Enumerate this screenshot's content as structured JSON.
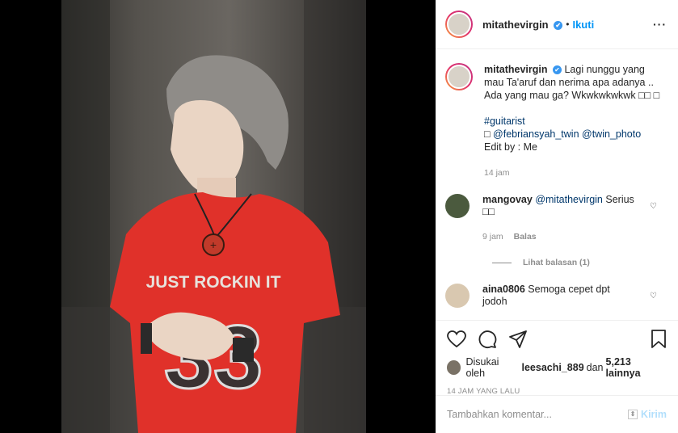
{
  "post": {
    "image_alt": "Photo by mitathevirgin",
    "shirt_text": "JUST ROCKIN IT",
    "shirt_number": "33"
  },
  "header": {
    "username": "mitathevirgin",
    "verified_icon": "✔",
    "separator": "•",
    "follow_label": "Ikuti",
    "more_label": "···"
  },
  "caption": {
    "username": "mitathevirgin",
    "text": "Lagi nunggu yang mau Ta'aruf dan nerima apa adanya .. Ada yang mau ga? Wkwkwkwkwk □□ □",
    "hashtag": "#guitarist",
    "credit_prefix": "□ ",
    "mention1": "@febriansyah_twin",
    "mention2": "@twin_photo",
    "edit_by": "Edit by : Me",
    "time": "14 jam"
  },
  "comments": [
    {
      "username": "mangovay",
      "mention": "@mitathevirgin",
      "text": " Serius □□",
      "time": "9 jam",
      "reply_label": "Balas",
      "view_replies": "Lihat balasan (1)"
    },
    {
      "username": "aina0806",
      "text": " Semoga cepet dpt jodoh"
    }
  ],
  "actions": {
    "likes_prefix": "Disukai oleh ",
    "liked_by": "leesachi_889",
    "likes_middle": " dan ",
    "likes_count": "5,213 lainnya",
    "timestamp": "14 JAM YANG LALU"
  },
  "add_comment": {
    "placeholder": "Tambahkan komentar...",
    "send_label": "Kirim"
  },
  "colors": {
    "accent": "#0095f6",
    "shirt": "#e0312a"
  }
}
